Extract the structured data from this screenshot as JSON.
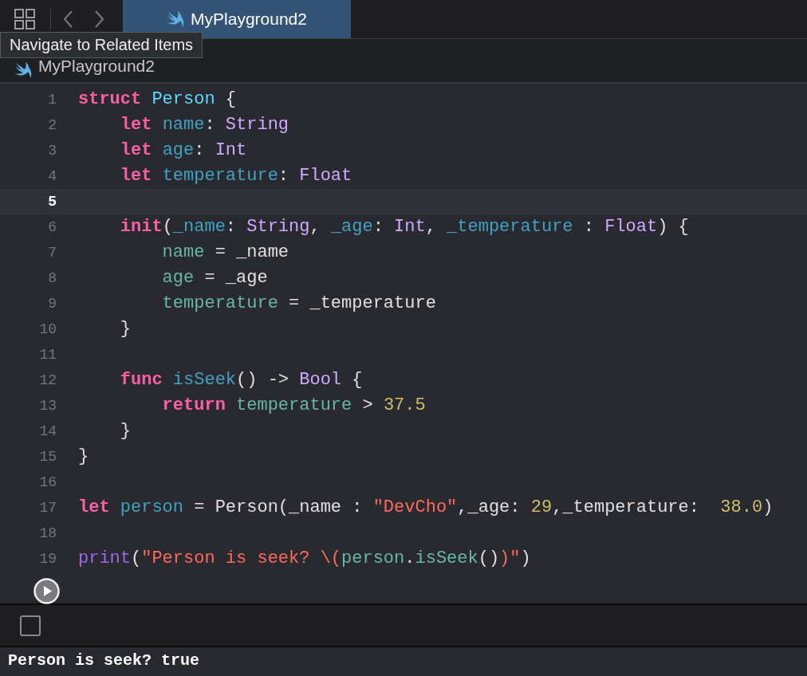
{
  "tab": {
    "title": "MyPlayground2",
    "selected": true
  },
  "tooltip": "Navigate to Related Items",
  "jump_bar": "MyPlayground2",
  "lines": [
    {
      "number": "1",
      "selected": false,
      "tokens": [
        {
          "kind": "kw",
          "text": "struct "
        },
        {
          "kind": "decl",
          "text": "Person"
        },
        {
          "kind": "plain",
          "text": " {"
        }
      ]
    },
    {
      "number": "2",
      "selected": false,
      "tokens": [
        {
          "kind": "kw",
          "text": "    let "
        },
        {
          "kind": "decl2",
          "text": "name"
        },
        {
          "kind": "plain",
          "text": ": "
        },
        {
          "kind": "type",
          "text": "String"
        }
      ]
    },
    {
      "number": "3",
      "selected": false,
      "tokens": [
        {
          "kind": "kw",
          "text": "    let "
        },
        {
          "kind": "decl2",
          "text": "age"
        },
        {
          "kind": "plain",
          "text": ": "
        },
        {
          "kind": "type",
          "text": "Int"
        }
      ]
    },
    {
      "number": "4",
      "selected": false,
      "tokens": [
        {
          "kind": "kw",
          "text": "    let "
        },
        {
          "kind": "decl2",
          "text": "temperature"
        },
        {
          "kind": "plain",
          "text": ": "
        },
        {
          "kind": "type",
          "text": "Float"
        }
      ]
    },
    {
      "number": "5",
      "selected": true
    },
    {
      "number": "6",
      "selected": false,
      "tokens": [
        {
          "kind": "kw",
          "text": "    init"
        },
        {
          "kind": "plain",
          "text": "("
        },
        {
          "kind": "decl2",
          "text": "_name"
        },
        {
          "kind": "plain",
          "text": ": "
        },
        {
          "kind": "type",
          "text": "String"
        },
        {
          "kind": "plain",
          "text": ", "
        },
        {
          "kind": "decl2",
          "text": "_age"
        },
        {
          "kind": "plain",
          "text": ": "
        },
        {
          "kind": "type",
          "text": "Int"
        },
        {
          "kind": "plain",
          "text": ", "
        },
        {
          "kind": "decl2",
          "text": "_temperature"
        },
        {
          "kind": "plain",
          "text": " : "
        },
        {
          "kind": "type",
          "text": "Float"
        },
        {
          "kind": "plain",
          "text": ") {"
        }
      ]
    },
    {
      "number": "7",
      "selected": false,
      "tokens": [
        {
          "kind": "prop",
          "text": "        name"
        },
        {
          "kind": "plain",
          "text": " = _name"
        }
      ]
    },
    {
      "number": "8",
      "selected": false,
      "tokens": [
        {
          "kind": "prop",
          "text": "        age"
        },
        {
          "kind": "plain",
          "text": " = _age"
        }
      ]
    },
    {
      "number": "9",
      "selected": false,
      "tokens": [
        {
          "kind": "prop",
          "text": "        temperature"
        },
        {
          "kind": "plain",
          "text": " = _temperature"
        }
      ]
    },
    {
      "number": "10",
      "selected": false,
      "tokens": [
        {
          "kind": "plain",
          "text": "    }"
        }
      ]
    },
    {
      "number": "11",
      "selected": false
    },
    {
      "number": "12",
      "selected": false,
      "tokens": [
        {
          "kind": "kw",
          "text": "    func "
        },
        {
          "kind": "decl2",
          "text": "isSeek"
        },
        {
          "kind": "plain",
          "text": "() -> "
        },
        {
          "kind": "type",
          "text": "Bool"
        },
        {
          "kind": "plain",
          "text": " {"
        }
      ]
    },
    {
      "number": "13",
      "selected": false,
      "tokens": [
        {
          "kind": "kw",
          "text": "        return "
        },
        {
          "kind": "prop",
          "text": "temperature"
        },
        {
          "kind": "plain",
          "text": " > "
        },
        {
          "kind": "num",
          "text": "37.5"
        }
      ]
    },
    {
      "number": "14",
      "selected": false,
      "tokens": [
        {
          "kind": "plain",
          "text": "    }"
        }
      ]
    },
    {
      "number": "15",
      "selected": false,
      "tokens": [
        {
          "kind": "plain",
          "text": "}"
        }
      ]
    },
    {
      "number": "16",
      "selected": false
    },
    {
      "number": "17",
      "selected": false,
      "tokens": [
        {
          "kind": "kw",
          "text": "let "
        },
        {
          "kind": "decl2",
          "text": "person"
        },
        {
          "kind": "plain",
          "text": " = Person(_name : "
        },
        {
          "kind": "str",
          "text": "\"DevCho\""
        },
        {
          "kind": "plain",
          "text": ",_age: "
        },
        {
          "kind": "num",
          "text": "29"
        },
        {
          "kind": "plain",
          "text": ",_temperature:  "
        },
        {
          "kind": "num",
          "text": "38.0"
        },
        {
          "kind": "plain",
          "text": ")"
        }
      ]
    },
    {
      "number": "18",
      "selected": false
    },
    {
      "number": "19",
      "selected": false,
      "tokens": [
        {
          "kind": "func",
          "text": "print"
        },
        {
          "kind": "plain",
          "text": "("
        },
        {
          "kind": "str",
          "text": "\"Person is seek? \\("
        },
        {
          "kind": "prop",
          "text": "person"
        },
        {
          "kind": "plain",
          "text": "."
        },
        {
          "kind": "prop",
          "text": "isSeek"
        },
        {
          "kind": "plain",
          "text": "()"
        },
        {
          "kind": "str",
          "text": ")\""
        },
        {
          "kind": "plain",
          "text": ")"
        }
      ]
    }
  ],
  "debug_checkbox": {
    "checked": false
  },
  "console_output": "Person is seek? true"
}
